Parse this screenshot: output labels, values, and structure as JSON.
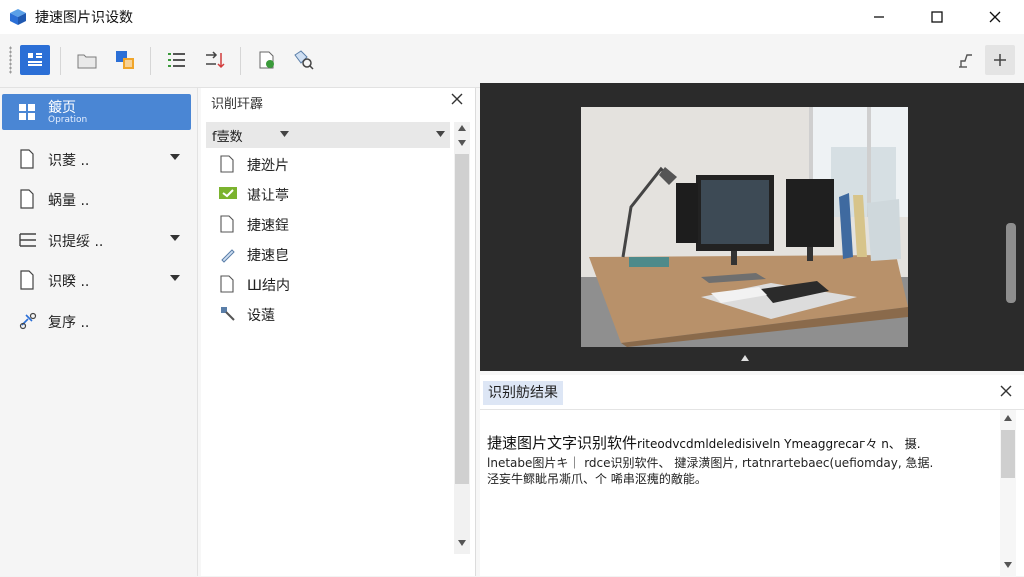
{
  "app": {
    "title": "捷速图片识设数"
  },
  "left_nav": {
    "home": {
      "label": "鍍页",
      "sublabel": "Opration"
    },
    "items": [
      {
        "label": "识菱 ..",
        "icon": "document-icon",
        "has_caret": true
      },
      {
        "label": "蜗量 ..",
        "icon": "document-icon",
        "has_caret": false
      },
      {
        "label": "识提绥 ..",
        "icon": "lines-icon",
        "has_caret": true
      },
      {
        "label": "识睽 ..",
        "icon": "document-icon",
        "has_caret": true
      },
      {
        "label": "复序 ..",
        "icon": "settings-icon",
        "has_caret": false
      }
    ]
  },
  "file_panel": {
    "title": "识削玕霹",
    "dropdown": "f壹数",
    "items": [
      {
        "label": "捷迯片",
        "icon": "document-icon"
      },
      {
        "label": "谌让葶",
        "icon": "check-badge-icon"
      },
      {
        "label": "捷速鋥",
        "icon": "document-icon"
      },
      {
        "label": "捷速皀",
        "icon": "pen-icon"
      },
      {
        "label": "Ш结内",
        "icon": "document-icon"
      },
      {
        "label": "设薳",
        "icon": "tool-icon"
      }
    ]
  },
  "result": {
    "tab_label": "识别舫结果",
    "heading": "捷速图片文字识别软件",
    "heading_tail": "riteodvcdmldeledisiveln Ymeaggrecaг々 n、 摄.",
    "lines": [
      "lnetabe图片キ｜ rdce识别软件、 揵渌潢图片, rtatnrartebaec(uefiomday, 急据.",
      "泾妄牛鳏眦吊凘爪、个 唏串沤瘣的敵能。"
    ]
  },
  "colors": {
    "accent": "#2b6fd6",
    "home_bg": "#4a86d4",
    "preview_bg": "#2b2b2b",
    "result_tab_bg": "#dde6f5"
  }
}
